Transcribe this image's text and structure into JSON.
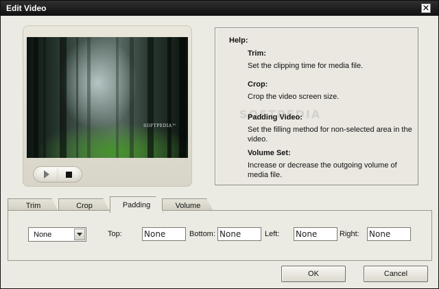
{
  "window": {
    "title": "Edit Video",
    "close_glyph": "✕"
  },
  "player": {
    "watermark": "SOFTPEDIA™",
    "controls": [
      {
        "name": "play-button",
        "icon": "play-icon"
      },
      {
        "name": "stop-button",
        "icon": "stop-icon"
      }
    ]
  },
  "help": {
    "heading": "Help:",
    "watermark": "SOFTPEDIA",
    "items": [
      {
        "title": "Trim:",
        "description": "Set the clipping time for media file."
      },
      {
        "title": "Crop:",
        "description": "Crop the video screen size."
      },
      {
        "title": "Padding Video:",
        "description": "Set the filling method for non-selected area in the video."
      },
      {
        "title": "Volume Set:",
        "description": "Increase or decrease the outgoing volume of media file."
      }
    ]
  },
  "tabs": [
    {
      "label": "Trim",
      "active": false
    },
    {
      "label": "Crop",
      "active": false
    },
    {
      "label": "Padding",
      "active": true
    },
    {
      "label": "Volume",
      "active": false
    }
  ],
  "padding": {
    "mode": "None",
    "top_label": "Top:",
    "top_value": "None",
    "bottom_label": "Bottom:",
    "bottom_value": "None",
    "left_label": "Left:",
    "left_value": "None",
    "right_label": "Right:",
    "right_value": "None"
  },
  "buttons": {
    "ok": "OK",
    "cancel": "Cancel"
  }
}
